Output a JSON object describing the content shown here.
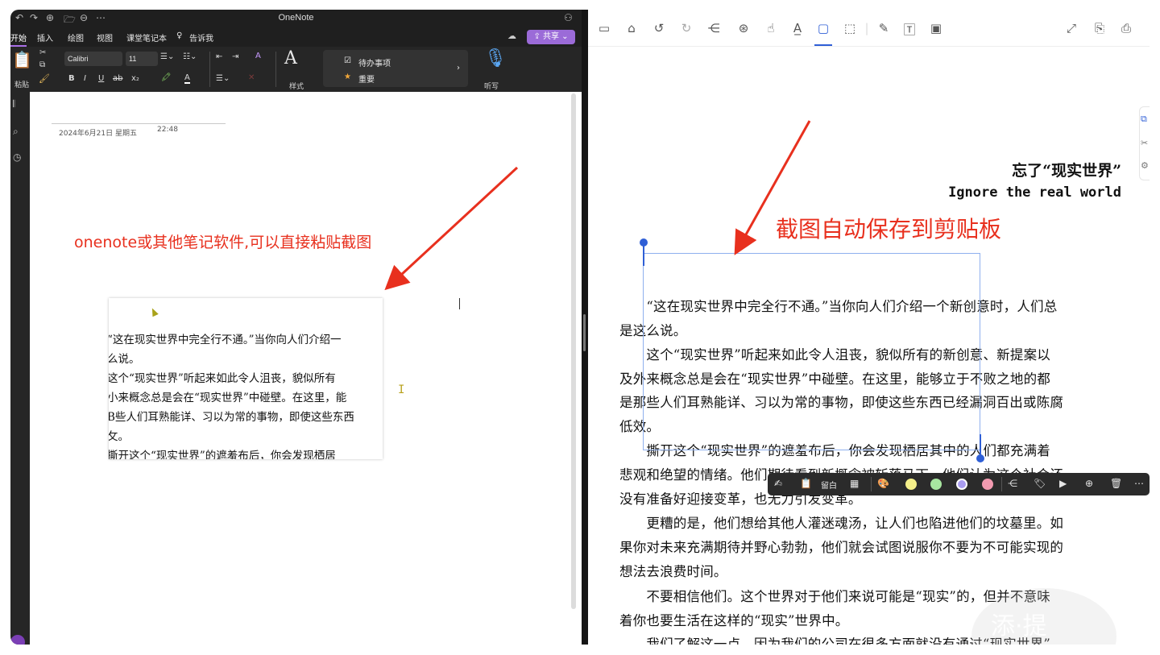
{
  "onenote": {
    "window_title": "OneNote",
    "quick_access": [
      "↶",
      "↷",
      "⊕",
      "🗁",
      "⊖",
      "⋯"
    ],
    "tabs": [
      "开始",
      "插入",
      "绘图",
      "视图",
      "课堂笔记本",
      "告诉我"
    ],
    "share_label": "共享",
    "ribbon": {
      "paste_label": "粘贴",
      "font_name": "Calibri",
      "font_size": "11",
      "styles_label": "样式",
      "dictate_label": "听写",
      "format_buttons": [
        "B",
        "I",
        "U",
        "ab",
        "x₂"
      ],
      "tags": [
        {
          "label": "待办事项",
          "icon": "checkbox-icon"
        },
        {
          "label": "重要",
          "icon": "star-icon"
        }
      ]
    },
    "page": {
      "date": "2024年6月21日  星期五",
      "time": "22:48",
      "annotation": "onenote或其他笔记软件,可以直接粘贴截图",
      "pasted_lines": [
        "“这在现实世界中完全行不通。”当你向人们介绍一",
        "么说。",
        " 这个“现实世界”听起来如此令人沮丧，貌似所有",
        "小来概念总是会在“现实世界”中碰壁。在这里，能",
        "B些人们耳熟能详、习以为常的事物，即使这些东西",
        "攵。",
        " 撕开这个“现实世界”的遮羞布后，你会发现栖居"
      ]
    }
  },
  "reader": {
    "heading": "忘了“现实世界”",
    "subheading": "Ignore the real world",
    "annotation": "截图自动保存到剪贴板",
    "body_lines": [
      "　　“这在现实世界中完全行不通。”当你向人们介绍一个新创意时，人们总",
      "是这么说。",
      "　　这个“现实世界”听起来如此令人沮丧，貌似所有的新创意、新提案以",
      "及外来概念总是会在“现实世界”中碰壁。在这里，能够立于不败之地的都",
      "是那些人们耳熟能详、习以为常的事物，即使这些东西已经漏洞百出或陈腐",
      "低效。",
      "　　撕开这个“现实世界”的遮羞布后，你会发现栖居其中的人们都充满着",
      "悲观和绝望的情绪。他们期待看到新概念被斩落马下，他们认为这个社会还",
      "没有准备好迎接变革，也无力引发变革。",
      "　　更糟的是，他们想给其他人灌迷魂汤，让人们也陷进他们的坟墓里。如",
      "果你对未来充满期待并野心勃勃，他们就会试图说服你不要为不可能实现的",
      "想法去浪费时间。",
      "　　不要相信他们。这个世界对于他们来说可能是“现实”的，但并不意味",
      "着你也要生活在这样的“现实”世界中。",
      "　　我们了解这一点，因为我们的公司在很多方面就没有通过“现实世界”"
    ],
    "floating_toolbar": {
      "item_label": "留白",
      "color_dots": [
        "#f5f08a",
        "#a8e6a0",
        "#a99cf0",
        "#f29ab0"
      ]
    },
    "watermark": "添·提"
  }
}
